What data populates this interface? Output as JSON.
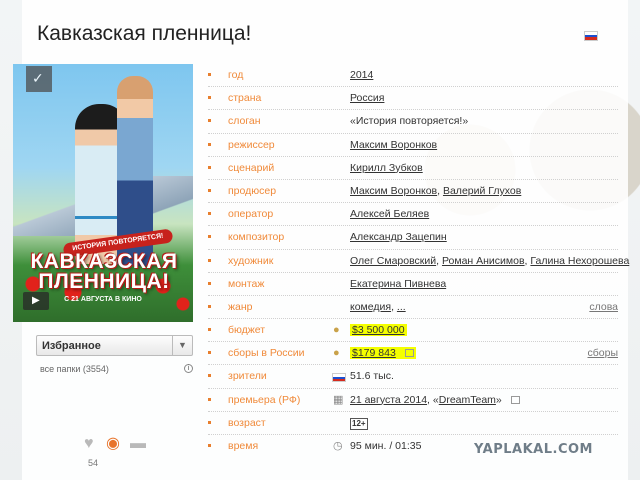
{
  "title": "Кавказская пленница!",
  "poster": {
    "tagline": "ИСТОРИЯ ПОВТОРЯЕТСЯ!",
    "title": "КАВКАЗСКАЯ\nПЛЕННИЦА!",
    "date": "С 21 АВГУСТА В КИНО"
  },
  "favorites": {
    "selected": "Избранное",
    "folders": "все папки (3554)"
  },
  "views_count": "54",
  "rows": [
    {
      "label": "год",
      "value": "2014"
    },
    {
      "label": "страна",
      "value": "Россия"
    },
    {
      "label": "слоган",
      "value": "«История повторяется!»"
    },
    {
      "label": "режиссер",
      "value": "Максим Воронков"
    },
    {
      "label": "сценарий",
      "value": "Кирилл Зубков"
    },
    {
      "label": "продюсер",
      "v1": "Максим Воронков",
      "sep": ", ",
      "v2": "Валерий Глухов"
    },
    {
      "label": "оператор",
      "value": "Алексей Беляев"
    },
    {
      "label": "композитор",
      "value": "Александр Зацепин"
    },
    {
      "label": "художник",
      "v1": "Олег Смаровский",
      "v2": "Роман Анисимов",
      "v3": "Галина Нехорошева"
    },
    {
      "label": "монтаж",
      "value": "Екатерина Пивнева"
    },
    {
      "label": "жанр",
      "v1": "комедия",
      "v2": "...",
      "right": "слова"
    },
    {
      "label": "бюджет",
      "value": "$3 500 000"
    },
    {
      "label": "сборы в России",
      "value": "$179 843",
      "right": "сборы"
    },
    {
      "label": "зрители",
      "value": "51.6 тыс."
    },
    {
      "label": "премьера (РФ)",
      "v1": "21 августа 2014",
      "v2": "DreamTeam"
    },
    {
      "label": "возраст",
      "value": "12+"
    },
    {
      "label": "время",
      "value": "95 мин. / 01:35"
    }
  ],
  "watermark": "YAPLAKAL.COM"
}
